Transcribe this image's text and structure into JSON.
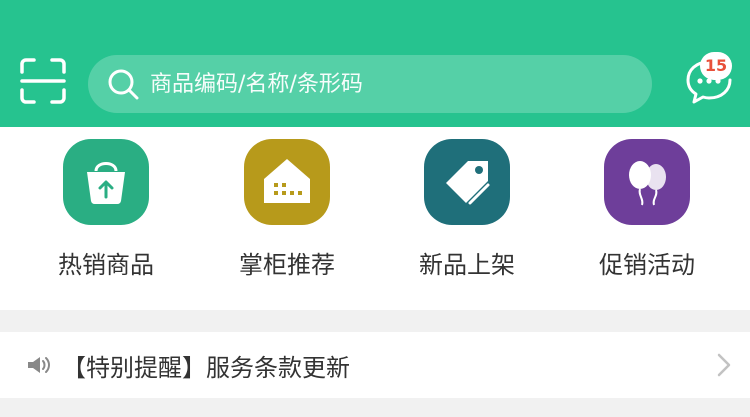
{
  "colors": {
    "header": "#26c38f",
    "hot": "#2aae83",
    "recommend": "#b79a1b",
    "new": "#1f6f7a",
    "promo": "#6e3e9a",
    "badge_text": "#e8503a"
  },
  "header": {
    "scan_icon": "scan-icon",
    "search": {
      "icon": "search-icon",
      "placeholder": "商品编码/名称/条形码"
    },
    "message": {
      "icon": "chat-bubble-icon",
      "badge_count": "15"
    }
  },
  "quick_links": [
    {
      "label": "热销商品",
      "icon": "shopping-bag-icon"
    },
    {
      "label": "掌柜推荐",
      "icon": "store-icon"
    },
    {
      "label": "新品上架",
      "icon": "tag-icon"
    },
    {
      "label": "促销活动",
      "icon": "balloon-icon"
    }
  ],
  "notice": {
    "icon": "megaphone-icon",
    "text": "【特别提醒】服务条款更新",
    "chevron_icon": "chevron-right-icon"
  }
}
